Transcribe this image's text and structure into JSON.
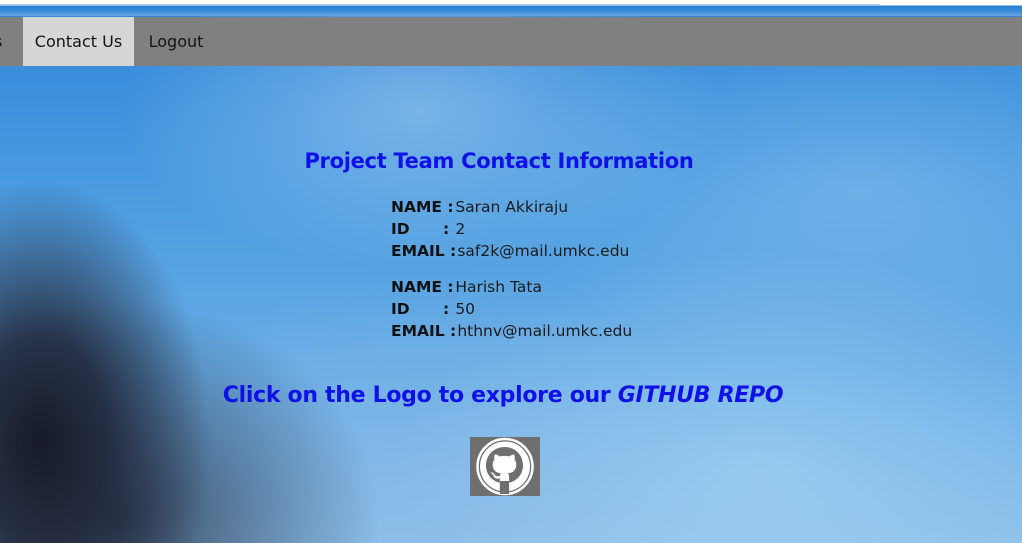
{
  "nav": {
    "prev_fragment": "s",
    "contact": "Contact Us",
    "logout": "Logout"
  },
  "heading": "Project Team Contact Information",
  "labels": {
    "name": "NAME :",
    "id": "ID",
    "id_colon": ":",
    "email": "EMAIL :"
  },
  "members": [
    {
      "name": "Saran Akkiraju",
      "id": "2",
      "email": "saf2k@mail.umkc.edu"
    },
    {
      "name": "Harish Tata",
      "id": "50",
      "email": "hthnv@mail.umkc.edu"
    }
  ],
  "cta": {
    "prefix": "Click on the Logo to explore our ",
    "emphasis": "GITHUB REPO"
  },
  "logo_icon": "github-octocat-icon",
  "colors": {
    "navbar": "#808080",
    "nav_active": "#d6d6d6",
    "heading": "#1010e8",
    "logo_bg": "#6f6f6f"
  }
}
